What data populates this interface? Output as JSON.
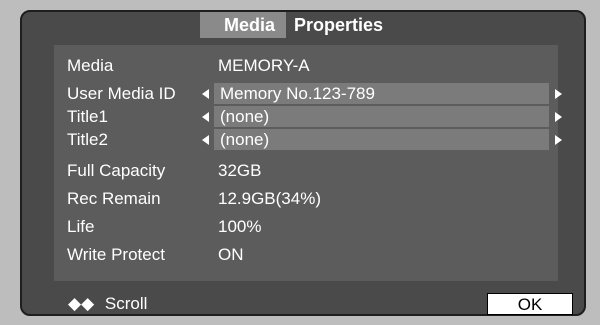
{
  "tabs": {
    "media": "Media",
    "properties": "Properties"
  },
  "rows": [
    {
      "label": "Media",
      "value": "MEMORY-A"
    },
    {
      "label": "User Media ID",
      "value": "Memory No.123-789"
    },
    {
      "label": "Title1",
      "value": "(none)"
    },
    {
      "label": "Title2",
      "value": "(none)"
    },
    {
      "label": "Full Capacity",
      "value": "32GB"
    },
    {
      "label": "Rec Remain",
      "value": "12.9GB(34%)"
    },
    {
      "label": "Life",
      "value": "100%"
    },
    {
      "label": "Write Protect",
      "value": "ON"
    }
  ],
  "footer": {
    "scroll_label": "Scroll",
    "ok_label": "OK"
  }
}
